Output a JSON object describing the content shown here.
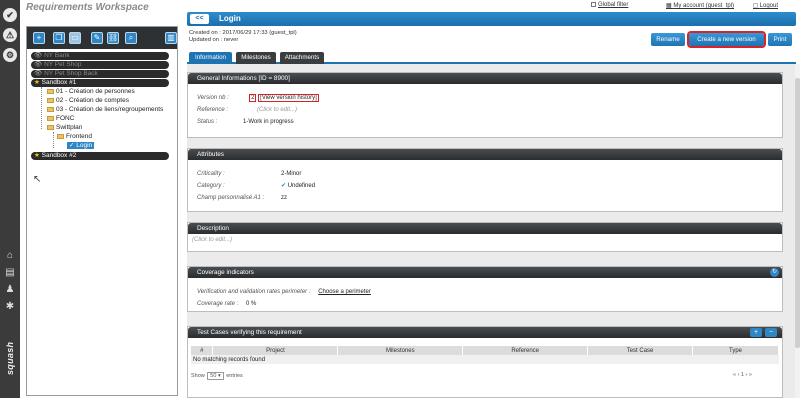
{
  "workspace_title": "Requirements Workspace",
  "topbar": {
    "global_filter": "Global filter",
    "my_account": "My account (guest_tpl)",
    "logout": "Logout"
  },
  "rail": {
    "logo": "squash"
  },
  "tree": {
    "nodes": [
      {
        "label": "NY Bank"
      },
      {
        "label": "NY Pet Shop"
      },
      {
        "label": "NY Pet Shop Back"
      },
      {
        "label": "Sandbox #1"
      },
      {
        "label": "01 - Création de personnes"
      },
      {
        "label": "02 - Création de comptes"
      },
      {
        "label": "03 - Création de liens/regroupements"
      },
      {
        "label": "FONC"
      },
      {
        "label": "Swittplan"
      },
      {
        "label": "Frontend"
      },
      {
        "label": "Login"
      },
      {
        "label": "Sandbox #2"
      }
    ]
  },
  "header": {
    "back": "<<",
    "title": "Login",
    "created": "Created on : 2017/06/29 17:33 (guest_tpl)",
    "updated": "Updated on : never"
  },
  "buttons": {
    "rename": "Rename",
    "new_version": "Create a new version",
    "print": "Print"
  },
  "tabs": [
    "Information",
    "Milestones",
    "Attachments"
  ],
  "general": {
    "title": "General Informations [ID = 8900]",
    "version_label": "Version nb :",
    "version_value": "2",
    "version_link": "[View version history]",
    "reference_label": "Reference :",
    "reference_placeholder": "(Click to edit...)",
    "status_label": "Status :",
    "status_value": "1-Work in progress"
  },
  "attributes": {
    "title": "Attributes",
    "criticality_label": "Criticality :",
    "criticality_value": "2-Minor",
    "category_label": "Category :",
    "category_value": "Undefined",
    "custom_label": "Champ personnalisé A1 :",
    "custom_value": "zz"
  },
  "description": {
    "title": "Description",
    "placeholder": "(Click to edit...)"
  },
  "coverage": {
    "title": "Coverage indicators",
    "perimeter_label": "Verification and validation rates perimeter :",
    "perimeter_link": "Choose a perimeter",
    "rate_label": "Coverage rate :",
    "rate_value": "0 %"
  },
  "testcases": {
    "title": "Test Cases verifying this requirement",
    "columns": [
      "#",
      "Project",
      "Milestones",
      "Reference",
      "Test Case",
      "Type"
    ],
    "empty": "No matching records found",
    "show": "Show",
    "page_size": "50",
    "entries": "entries",
    "pager": "« ‹ 1 › »"
  }
}
